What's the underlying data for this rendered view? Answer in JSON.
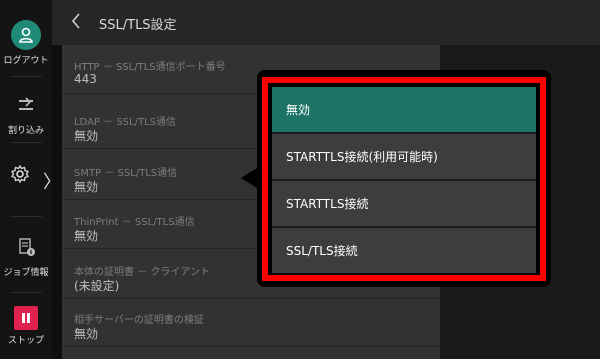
{
  "sidebar": {
    "logout_label": "ログアウト",
    "interrupt_label": "割り込み",
    "job_info_label": "ジョブ情報",
    "stop_label": "ストップ"
  },
  "header": {
    "title": "SSL/TLS設定"
  },
  "settings": [
    {
      "label": "HTTP － SSL/TLS通信ポート番号",
      "value": "443"
    },
    {
      "label": "LDAP － SSL/TLS通信",
      "value": "無効"
    },
    {
      "label": "SMTP － SSL/TLS通信",
      "value": "無効"
    },
    {
      "label": "ThinPrint － SSL/TLS通信",
      "value": "無効"
    },
    {
      "label": "本体の証明書 － クライアント",
      "value": "(未設定)"
    },
    {
      "label": "相手サーバーの証明書の検証",
      "value": "無効"
    }
  ],
  "popup": {
    "options": [
      {
        "label": "無効",
        "selected": true
      },
      {
        "label": "STARTTLS接続(利用可能時)",
        "selected": false
      },
      {
        "label": "STARTTLS接続",
        "selected": false
      },
      {
        "label": "SSL/TLS接続",
        "selected": false
      }
    ]
  },
  "colors": {
    "accent": "#1f8a78",
    "selected_option": "#1d7466",
    "highlight_frame": "#ff0000",
    "stop": "#e0234e"
  }
}
